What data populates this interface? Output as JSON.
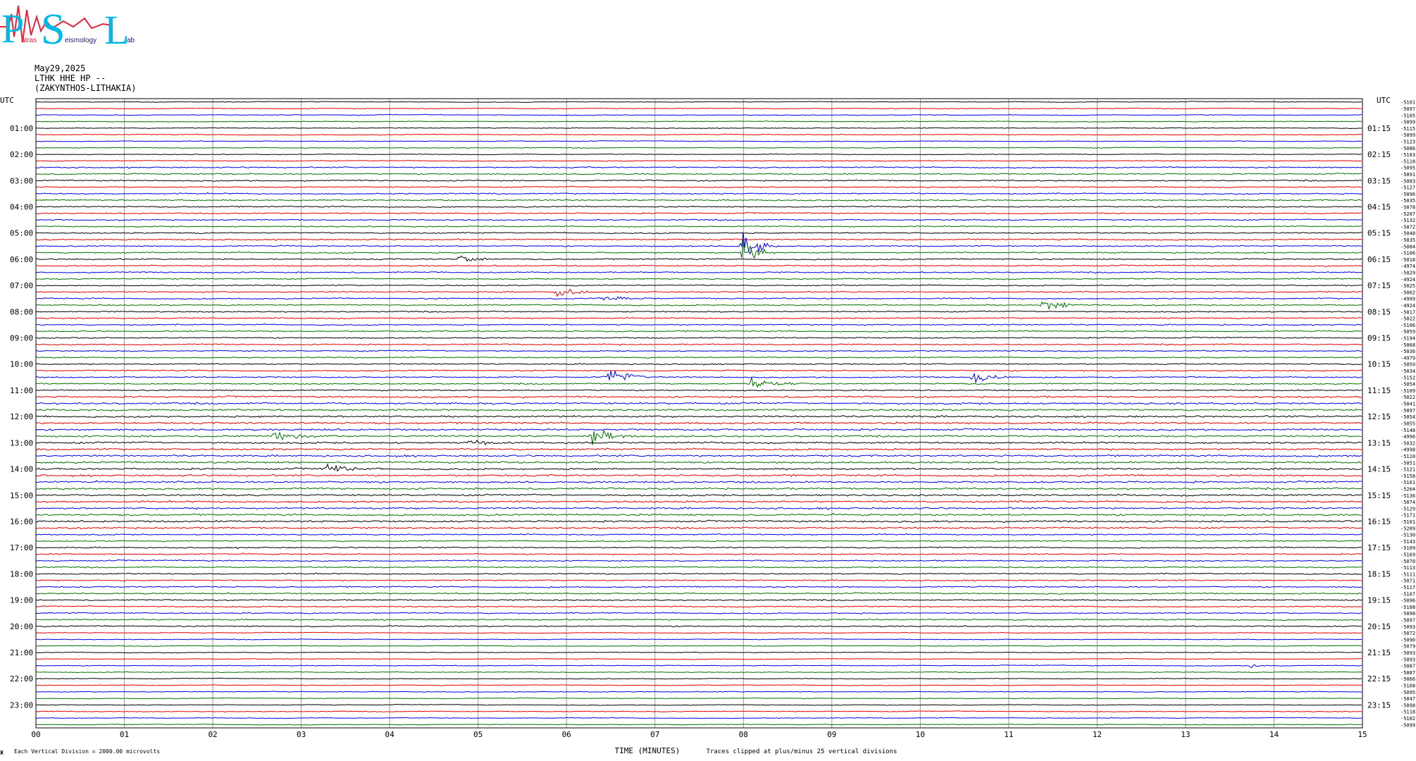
{
  "header": {
    "date": "May29,2025",
    "station": "LTHK HHE HP --",
    "location": "(ZAKYNTHOS-LITHAKIA)"
  },
  "logo": {
    "letters": [
      "P",
      "S",
      "L"
    ],
    "words": [
      "atras",
      "eismology",
      "ab"
    ],
    "colors": {
      "cyan": "#00b8e6",
      "red": "#e8213a"
    }
  },
  "footer": {
    "vertical_division_note": "Each Vertical Division = 2000.00 microvolts",
    "clip_note": "Traces clipped at plus/minus 25 vertical divisions",
    "corner_mark": "Ж"
  },
  "chart_data": {
    "type": "line",
    "title": "",
    "xlabel": "TIME (MINUTES)",
    "ylabel": "",
    "xlim": [
      0,
      15
    ],
    "x_ticks": [
      "00",
      "01",
      "02",
      "03",
      "04",
      "05",
      "06",
      "07",
      "08",
      "09",
      "10",
      "11",
      "12",
      "13",
      "14",
      "15"
    ],
    "left_axis_title": "UTC",
    "right_axis_title": "UTC",
    "left_hour_labels": [
      "01:00",
      "02:00",
      "03:00",
      "04:00",
      "05:00",
      "06:00",
      "07:00",
      "08:00",
      "09:00",
      "10:00",
      "11:00",
      "12:00",
      "13:00",
      "14:00",
      "15:00",
      "16:00",
      "17:00",
      "18:00",
      "19:00",
      "20:00",
      "21:00",
      "22:00",
      "23:00"
    ],
    "right_hour_labels": [
      "01:15",
      "02:15",
      "03:15",
      "04:15",
      "05:15",
      "06:15",
      "07:15",
      "08:15",
      "09:15",
      "10:15",
      "11:15",
      "12:15",
      "13:15",
      "14:15",
      "15:15",
      "16:15",
      "17:15",
      "18:15",
      "19:15",
      "20:15",
      "21:15",
      "22:15",
      "23:15"
    ],
    "trace_colors": [
      "#000000",
      "#e00000",
      "#0000e0",
      "#007000"
    ],
    "trace_count": 96,
    "trace_minutes_each": 15,
    "trace_offsets": [
      "-5101",
      "-5097",
      "-5105",
      "-5099",
      "-5115",
      "-5099",
      "-5123",
      "-5086",
      "-5103",
      "-5118",
      "-5095",
      "-5091",
      "-5083",
      "-5127",
      "-5096",
      "-5035",
      "-5078",
      "-5207",
      "-5132",
      "-5072",
      "-5048",
      "-5035",
      "-5084",
      "-5106",
      "-5018",
      "-4974",
      "-5029",
      "-4924",
      "-5025",
      "-5002",
      "-4999",
      "-4924",
      "-5017",
      "-5022",
      "-5106",
      "-5059",
      "-5194",
      "-5068",
      "-5036",
      "-4979",
      "-5059",
      "-5034",
      "-5152",
      "-5054",
      "-5109",
      "-5022",
      "-5041",
      "-5097",
      "-5054",
      "-5055",
      "-5148",
      "-4996",
      "-5032",
      "-4998",
      "-5110",
      "-5051",
      "-5121",
      "-5158",
      "-5161",
      "-5264",
      "-5136",
      "-5074",
      "-5129",
      "-5171",
      "-5101",
      "-5209",
      "-5130",
      "-5143",
      "-5109",
      "-5169",
      "-5070",
      "-5113",
      "-5111",
      "-5071",
      "-5117",
      "-5107",
      "-5096",
      "-5108",
      "-5090",
      "-5097",
      "-5093",
      "-5072",
      "-5090",
      "-5079",
      "-5093",
      "-5093",
      "-5087",
      "-5087",
      "-5066",
      "-5108",
      "-5095",
      "-5047",
      "-5098",
      "-5118",
      "-5102",
      "-5099"
    ],
    "events": [
      {
        "trace": 22,
        "minute": 8.0,
        "amplitude": 45,
        "duration": 0.4
      },
      {
        "trace": 23,
        "minute": 8.0,
        "amplitude": 30,
        "duration": 0.45
      },
      {
        "trace": 24,
        "minute": 4.8,
        "amplitude": 12,
        "duration": 0.5
      },
      {
        "trace": 29,
        "minute": 5.9,
        "amplitude": 18,
        "duration": 0.5
      },
      {
        "trace": 30,
        "minute": 6.4,
        "amplitude": 10,
        "duration": 0.6
      },
      {
        "trace": 31,
        "minute": 11.4,
        "amplitude": 26,
        "duration": 0.45
      },
      {
        "trace": 42,
        "minute": 6.5,
        "amplitude": 22,
        "duration": 0.55
      },
      {
        "trace": 42,
        "minute": 10.6,
        "amplitude": 20,
        "duration": 0.5
      },
      {
        "trace": 43,
        "minute": 8.1,
        "amplitude": 18,
        "duration": 0.6
      },
      {
        "trace": 51,
        "minute": 2.7,
        "amplitude": 16,
        "duration": 0.6
      },
      {
        "trace": 51,
        "minute": 6.3,
        "amplitude": 20,
        "duration": 0.55
      },
      {
        "trace": 52,
        "minute": 4.9,
        "amplitude": 12,
        "duration": 0.5
      },
      {
        "trace": 56,
        "minute": 3.3,
        "amplitude": 14,
        "duration": 0.6
      },
      {
        "trace": 86,
        "minute": 13.75,
        "amplitude": 9,
        "duration": 0.3
      }
    ]
  }
}
